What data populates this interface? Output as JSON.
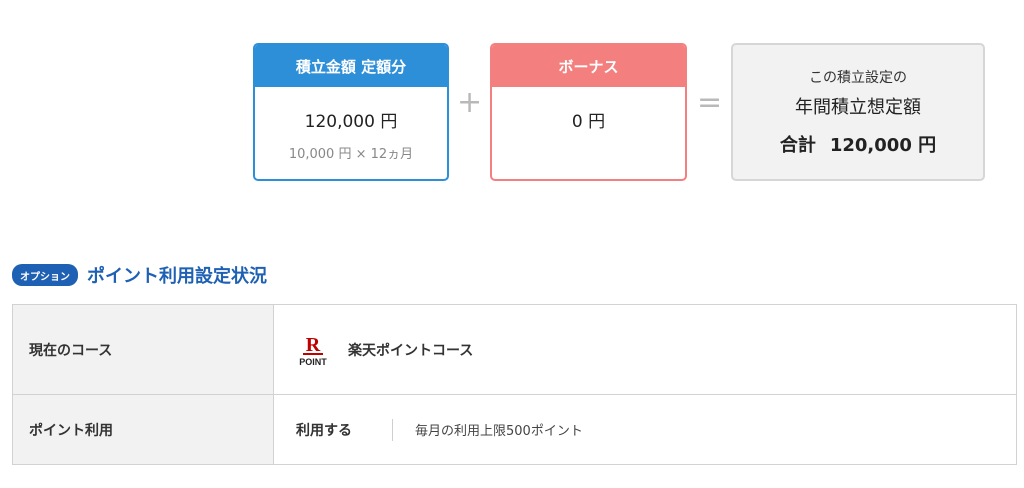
{
  "summary": {
    "monthly": {
      "title": "積立金額 定額分",
      "amount": "120,000 円",
      "breakdown": "10,000 円  × 12ヵ月"
    },
    "plus_symbol": "+",
    "bonus": {
      "title": "ボーナス",
      "amount": "0 円"
    },
    "equals_symbol": "=",
    "total": {
      "line1": "この積立設定の",
      "line2": "年間積立想定額",
      "sum_label": "合計",
      "sum_value": "120,000 円"
    }
  },
  "option_section": {
    "badge": "オプション",
    "title": "ポイント利用設定状況",
    "rows": [
      {
        "label": "現在のコース",
        "logo_text": "POINT",
        "course": "楽天ポイントコース"
      },
      {
        "label": "ポイント利用",
        "status": "利用する",
        "detail": "毎月の利用上限500ポイント"
      }
    ]
  },
  "colors": {
    "monthly_accent": "#2e8fd9",
    "bonus_accent": "#f3807f",
    "section_accent": "#1e60b3",
    "rakuten_red": "#bf0000"
  }
}
